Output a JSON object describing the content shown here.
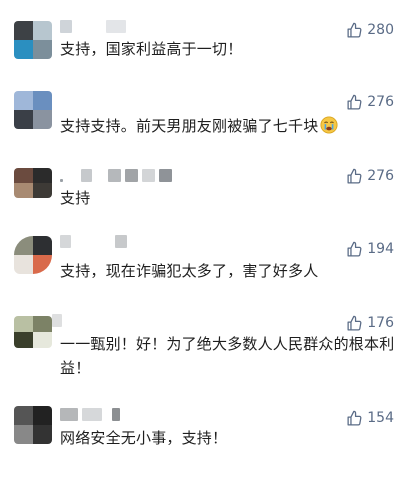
{
  "comments": [
    {
      "avatar_colors": [
        "#3d4145",
        "#b7c6cf",
        "#2b8fc0",
        "#7c8f9b"
      ],
      "nickname_colors": [
        "#cfd4d9",
        "#e3e5e8"
      ],
      "text": "支持，国家利益高于一切！",
      "likes": "280"
    },
    {
      "avatar_colors": [
        "#9fb7d9",
        "#6a8fbf",
        "#3a3f47",
        "#8a93a0"
      ],
      "nickname_colors": [],
      "text": "支持支持。前天男朋友刚被骗了七千块",
      "emoji": "crying-emoji",
      "likes": "276"
    },
    {
      "avatar_colors": [
        "#6b4b3f",
        "#2b2b2b",
        "#a88a72",
        "#3d3a36"
      ],
      "nickname_colors": [
        "#9aa0a6",
        "#c6c9cc",
        "#b5b8bb",
        "#a1a4a7",
        "#d3d5d7",
        "#8f9398"
      ],
      "text": "支持",
      "likes": "276"
    },
    {
      "avatar_colors": [
        "#8b8d7c",
        "#2d2f32",
        "#e8e3dd",
        "#d96a4b"
      ],
      "nickname_colors": [
        "#d5d7d9",
        "#c7c9cb"
      ],
      "text": "支持，现在诈骗犯太多了，害了好多人",
      "likes": "194"
    },
    {
      "avatar_colors": [
        "#b9c0a3",
        "#7c8266",
        "#3a3f2b",
        "#e6e8dc"
      ],
      "nickname_colors": [
        "#dedfe0"
      ],
      "text": "一一甄别！好！为了绝大多数人人民群众的根本利益！",
      "likes": "176"
    },
    {
      "avatar_colors": [
        "#555555",
        "#222222",
        "#888888",
        "#333333"
      ],
      "nickname_colors": [
        "#b5b7b9",
        "#d6d8da",
        "#8c8f92"
      ],
      "text": "网络安全无小事，支持！",
      "likes": "154"
    }
  ],
  "colors": {
    "like_color": "#5a6b86",
    "text_color": "#1e1e1e"
  }
}
